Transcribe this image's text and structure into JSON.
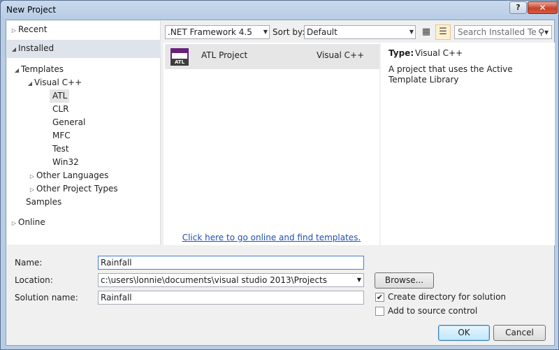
{
  "window": {
    "title": "New Project",
    "help_label": "?",
    "close_label": "✕"
  },
  "tree": {
    "recent": "Recent",
    "installed": "Installed",
    "templates": "Templates",
    "visual_cpp": "Visual C++",
    "children": [
      "ATL",
      "CLR",
      "General",
      "MFC",
      "Test",
      "Win32"
    ],
    "other_languages": "Other Languages",
    "other_project_types": "Other Project Types",
    "samples": "Samples",
    "online": "Online"
  },
  "toolbar": {
    "framework": ".NET Framework 4.5",
    "sort_label": "Sort by:",
    "sort_value": "Default",
    "search_placeholder": "Search Installed Te"
  },
  "templates_list": [
    {
      "name": "ATL Project",
      "language": "Visual C++",
      "icon_text": "ATL"
    }
  ],
  "online_link": "Click here to go online and find templates.",
  "details": {
    "type_label": "Type:",
    "type_value": "Visual C++",
    "description": "A project that uses the Active Template Library"
  },
  "form": {
    "name_label": "Name:",
    "name_value": "Rainfall",
    "location_label": "Location:",
    "location_value": "c:\\users\\lonnie\\documents\\visual studio 2013\\Projects",
    "solution_label": "Solution name:",
    "solution_value": "Rainfall",
    "browse_label": "Browse...",
    "create_dir_label": "Create directory for solution",
    "create_dir_checked": "✔",
    "source_control_label": "Add to source control",
    "ok_label": "OK",
    "cancel_label": "Cancel"
  },
  "colors": {
    "accent": "#68217a",
    "link": "#1e4fb2",
    "selection": "#e5e5e5"
  }
}
